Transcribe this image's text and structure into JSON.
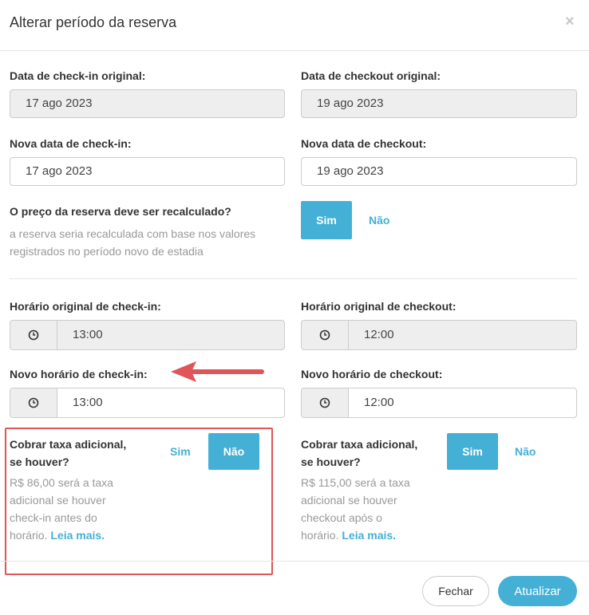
{
  "dialog": {
    "title": "Alterar período da reserva",
    "close_symbol": "×"
  },
  "dates": {
    "original_checkin_label": "Data de check-in original:",
    "original_checkin_value": "17 ago 2023",
    "original_checkout_label": "Data de checkout original:",
    "original_checkout_value": "19 ago 2023",
    "new_checkin_label": "Nova data de check-in:",
    "new_checkin_value": "17 ago 2023",
    "new_checkout_label": "Nova data de checkout:",
    "new_checkout_value": "19 ago 2023"
  },
  "recalc": {
    "question": "O preço da reserva deve ser recalculado?",
    "help": "a reserva seria recalculada com base nos valores registrados no período novo de estadia",
    "yes_label": "Sim",
    "no_label": "Não",
    "selected": "Sim"
  },
  "times": {
    "original_checkin_label": "Horário original de check-in:",
    "original_checkin_value": "13:00",
    "original_checkout_label": "Horário original de checkout:",
    "original_checkout_value": "12:00",
    "new_checkin_label": "Novo horário de check-in:",
    "new_checkin_value": "13:00",
    "new_checkout_label": "Novo horário de checkout:",
    "new_checkout_value": "12:00",
    "clock_icon": "clock-icon"
  },
  "fee_checkin": {
    "question_line1": "Cobrar taxa adicional,",
    "question_line2": "se houver?",
    "yes_label": "Sim",
    "no_label": "Não",
    "selected": "Não",
    "help_line1": "R$ 86,00 será a taxa",
    "help_line2": "adicional se houver",
    "help_line3": "check-in antes do",
    "help_line4": "horário.",
    "more_link": "Leia mais."
  },
  "fee_checkout": {
    "question_line1": "Cobrar taxa adicional,",
    "question_line2": "se houver?",
    "yes_label": "Sim",
    "no_label": "Não",
    "selected": "Sim",
    "help_line1": "R$ 115,00 será a taxa",
    "help_line2": "adicional se houver",
    "help_line3": "checkout após o",
    "help_line4": "horário.",
    "more_link": "Leia mais."
  },
  "footer": {
    "close_label": "Fechar",
    "update_label": "Atualizar"
  },
  "colors": {
    "accent": "#45b0d6",
    "annotation": "#e0555a",
    "readonly_bg": "#eeeeee"
  }
}
